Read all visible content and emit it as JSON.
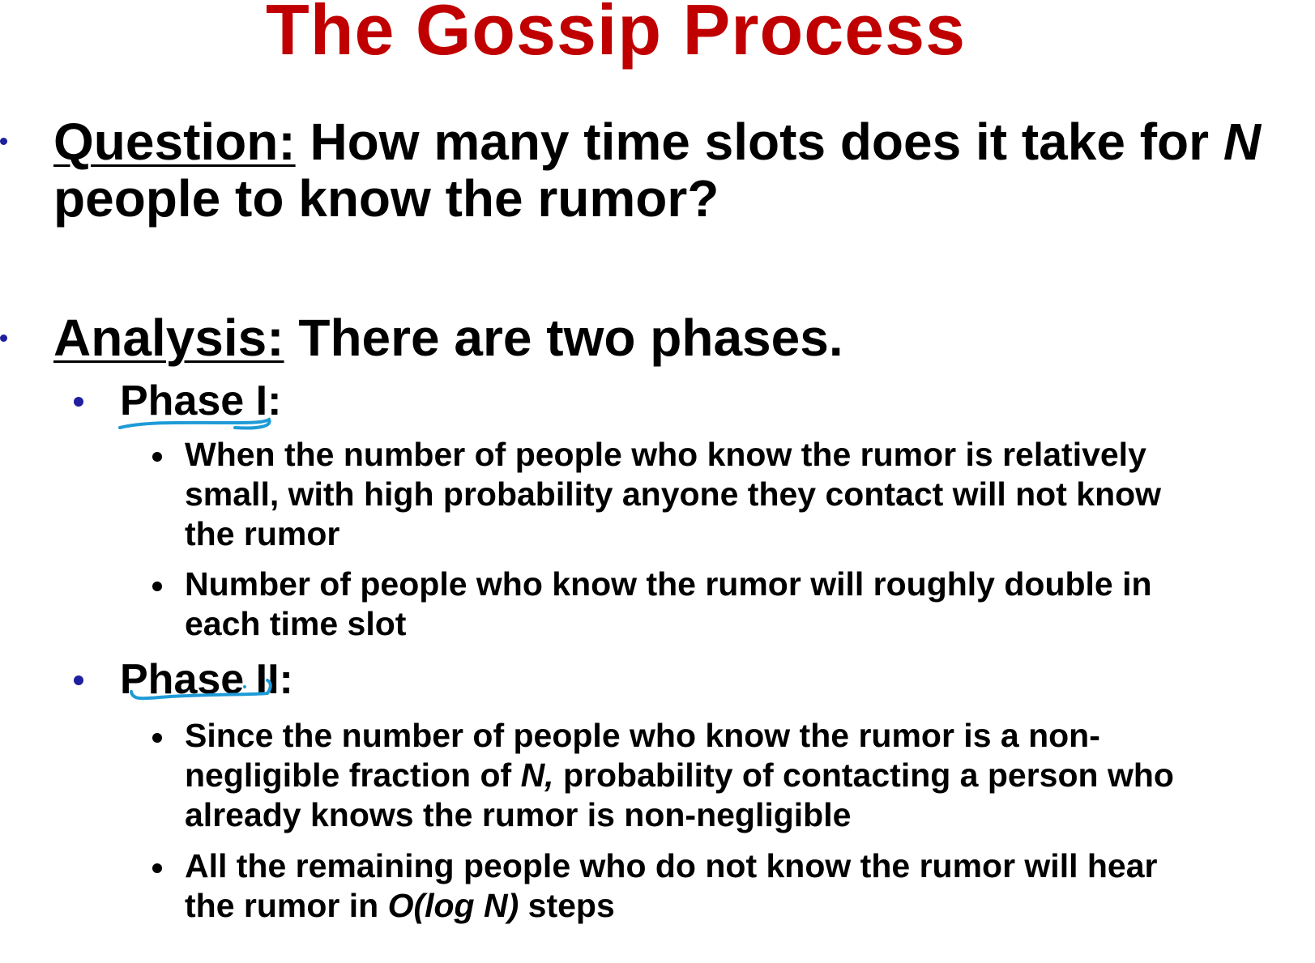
{
  "title": "The Gossip Process",
  "colors": {
    "title": "#c00000",
    "text": "#000000",
    "bullet": "#1f1fa0",
    "annotation": "#1e9bd7"
  },
  "question": {
    "label": "Question:",
    "line1_text": " How many time slots does it take for ",
    "line1_var": "N",
    "line2_text": "people to know the rumor?"
  },
  "analysis": {
    "label": "Analysis:",
    "text": " There are two phases."
  },
  "phase1": {
    "label": "Phase I:",
    "bullets": [
      {
        "lines": [
          "When the number of people who know the rumor is relatively",
          "small, with high probability anyone they contact will not know",
          "the rumor"
        ]
      },
      {
        "lines": [
          "Number of people who know the rumor will roughly double in",
          "each time slot"
        ]
      }
    ]
  },
  "phase2": {
    "label": "Phase II:",
    "bullet1": {
      "line1": "Since the number of people who know the rumor is a non-",
      "line2_a": "negligible fraction of ",
      "line2_var": "N,",
      "line2_b": " probability of contacting a person who",
      "line3": "already knows the rumor is non-negligible"
    },
    "bullet2": {
      "line1": "All the remaining people who do not know the rumor will hear",
      "line2_a": "the rumor in ",
      "line2_italic": "O(log N)",
      "line2_b": " steps"
    }
  }
}
